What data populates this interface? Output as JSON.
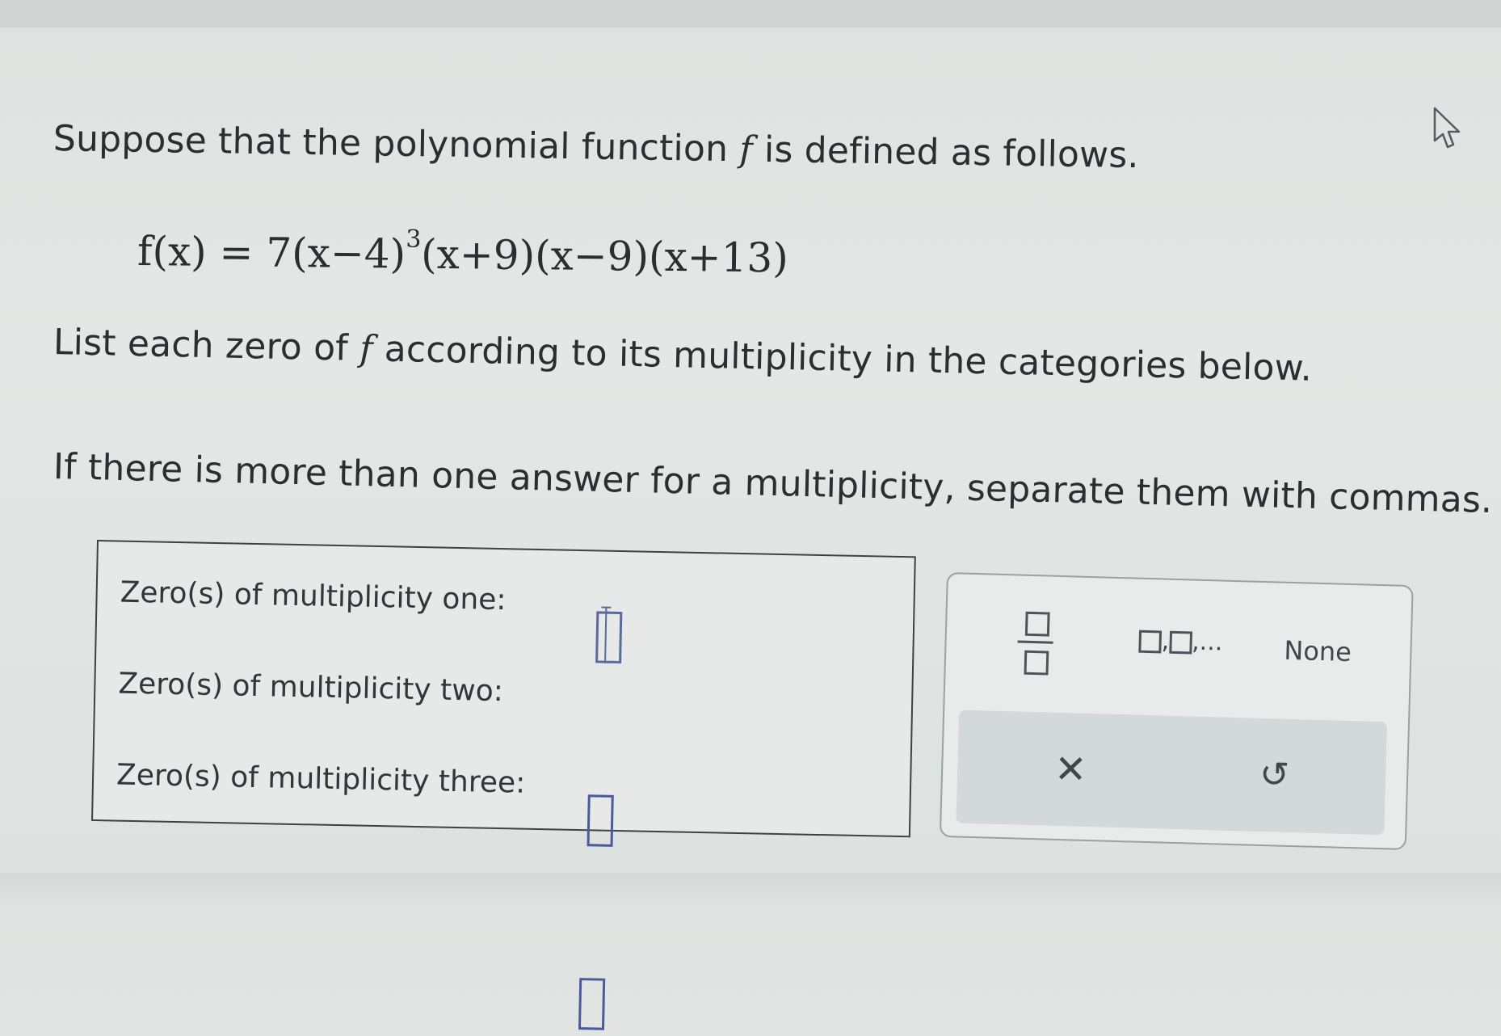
{
  "question": {
    "intro_prefix": "Suppose that the polynomial function ",
    "function_name": "f",
    "intro_suffix": " is defined as follows.",
    "formula": "f(x) = 7(x−4)",
    "formula_exponent": "3",
    "formula_rest": "(x+9)(x−9)(x+13)",
    "instruction_prefix": "List each zero of ",
    "instruction_suffix": " according to its multiplicity in the categories below.",
    "note": "If there is more than one answer for a multiplicity, separate them with commas. If ther"
  },
  "answers": {
    "rows": [
      {
        "label": "Zero(s) of multiplicity one:",
        "value": ""
      },
      {
        "label": "Zero(s) of multiplicity two:",
        "value": ""
      },
      {
        "label": "Zero(s) of multiplicity three:",
        "value": ""
      }
    ]
  },
  "keypad": {
    "list_label": ",",
    "list_ellipsis": ",...",
    "none_label": "None",
    "clear_symbol": "✕",
    "undo_symbol": "↺"
  },
  "colors": {
    "input_border": "#4a5a9a",
    "background": "#e4e7e5"
  },
  "icons": [
    "mouse-cursor-icon",
    "fraction-icon",
    "list-icon",
    "clear-icon",
    "undo-icon"
  ]
}
